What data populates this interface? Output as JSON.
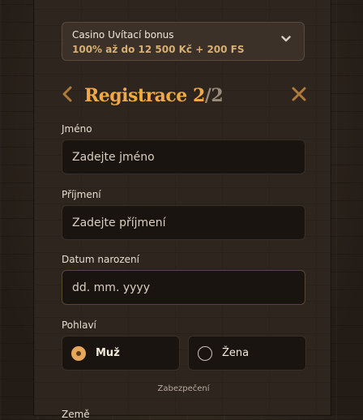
{
  "bonus": {
    "title": "Casino Uvítací bonus",
    "description": "100% až do 12 500 Kč + 200 FS",
    "expand_icon": "chevron-down-icon"
  },
  "header": {
    "back_icon": "chevron-left-icon",
    "title": "Registrace",
    "step": "2",
    "total": "/2",
    "close_icon": "close-icon"
  },
  "form": {
    "first_name": {
      "label": "Jméno",
      "placeholder": "Zadejte jméno",
      "value": ""
    },
    "last_name": {
      "label": "Příjmení",
      "placeholder": "Zadejte příjmení",
      "value": ""
    },
    "birthdate": {
      "label": "Datum narození",
      "placeholder": "dd. mm. yyyy",
      "value": ""
    },
    "gender": {
      "label": "Pohlaví",
      "options": [
        {
          "label": "Muž",
          "selected": true
        },
        {
          "label": "Žena",
          "selected": false
        }
      ]
    },
    "section_divider": "Zabezpečení",
    "next_label_partial": "Země"
  },
  "colors": {
    "accent": "#f0a948",
    "bonus_text": "#d8ae74",
    "field_bg": "#1a1411",
    "panel_bg": "#2e251e"
  }
}
